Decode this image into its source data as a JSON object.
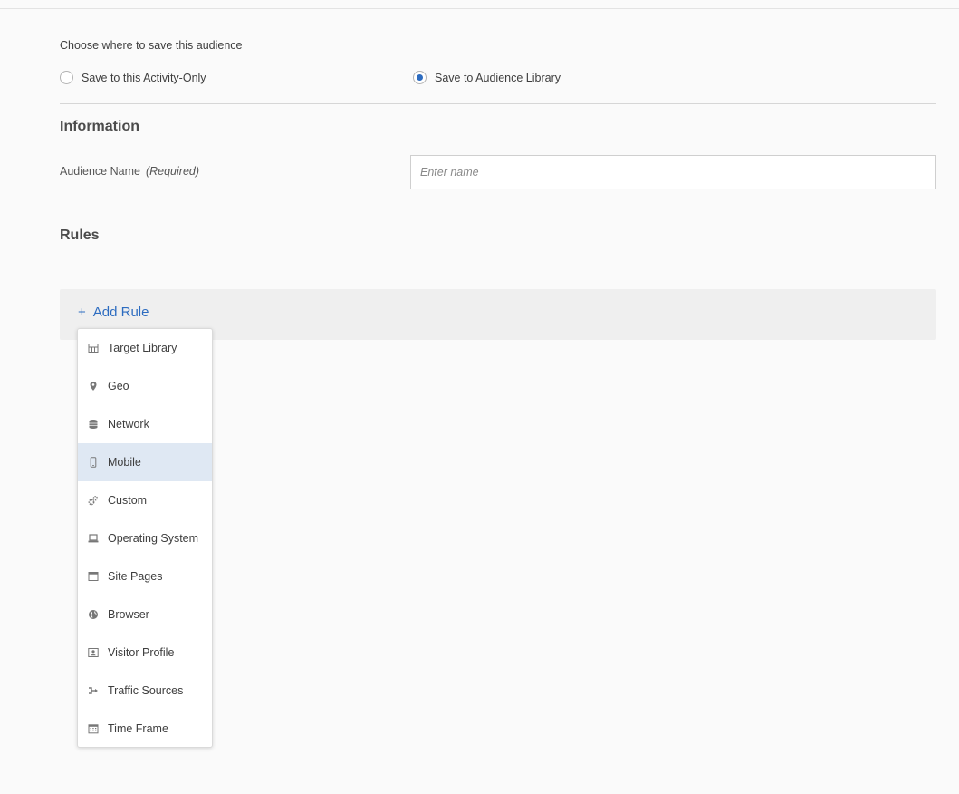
{
  "save_location": {
    "prompt": "Choose where to save this audience",
    "options": [
      {
        "label": "Save to this Activity-Only",
        "checked": false
      },
      {
        "label": "Save to Audience Library",
        "checked": true
      }
    ]
  },
  "information": {
    "heading": "Information",
    "audience_name_label": "Audience Name",
    "required_label": "(Required)",
    "audience_name_placeholder": "Enter name",
    "audience_name_value": ""
  },
  "rules": {
    "heading": "Rules",
    "add_rule_plus": "+",
    "add_rule_label": "Add Rule"
  },
  "rule_menu": {
    "items": [
      {
        "label": "Target Library",
        "icon": "target-library-icon",
        "selected": false
      },
      {
        "label": "Geo",
        "icon": "map-pin-icon",
        "selected": false
      },
      {
        "label": "Network",
        "icon": "database-icon",
        "selected": false
      },
      {
        "label": "Mobile",
        "icon": "mobile-phone-icon",
        "selected": true
      },
      {
        "label": "Custom",
        "icon": "gears-icon",
        "selected": false
      },
      {
        "label": "Operating System",
        "icon": "laptop-icon",
        "selected": false
      },
      {
        "label": "Site Pages",
        "icon": "web-page-icon",
        "selected": false
      },
      {
        "label": "Browser",
        "icon": "globe-icon",
        "selected": false
      },
      {
        "label": "Visitor Profile",
        "icon": "profile-card-icon",
        "selected": false
      },
      {
        "label": "Traffic Sources",
        "icon": "traffic-arrow-icon",
        "selected": false
      },
      {
        "label": "Time Frame",
        "icon": "calendar-icon",
        "selected": false
      }
    ]
  },
  "colors": {
    "accent": "#2d6cc0",
    "selected_item_bg": "#dfe8f3",
    "panel_bg": "#efefef"
  }
}
